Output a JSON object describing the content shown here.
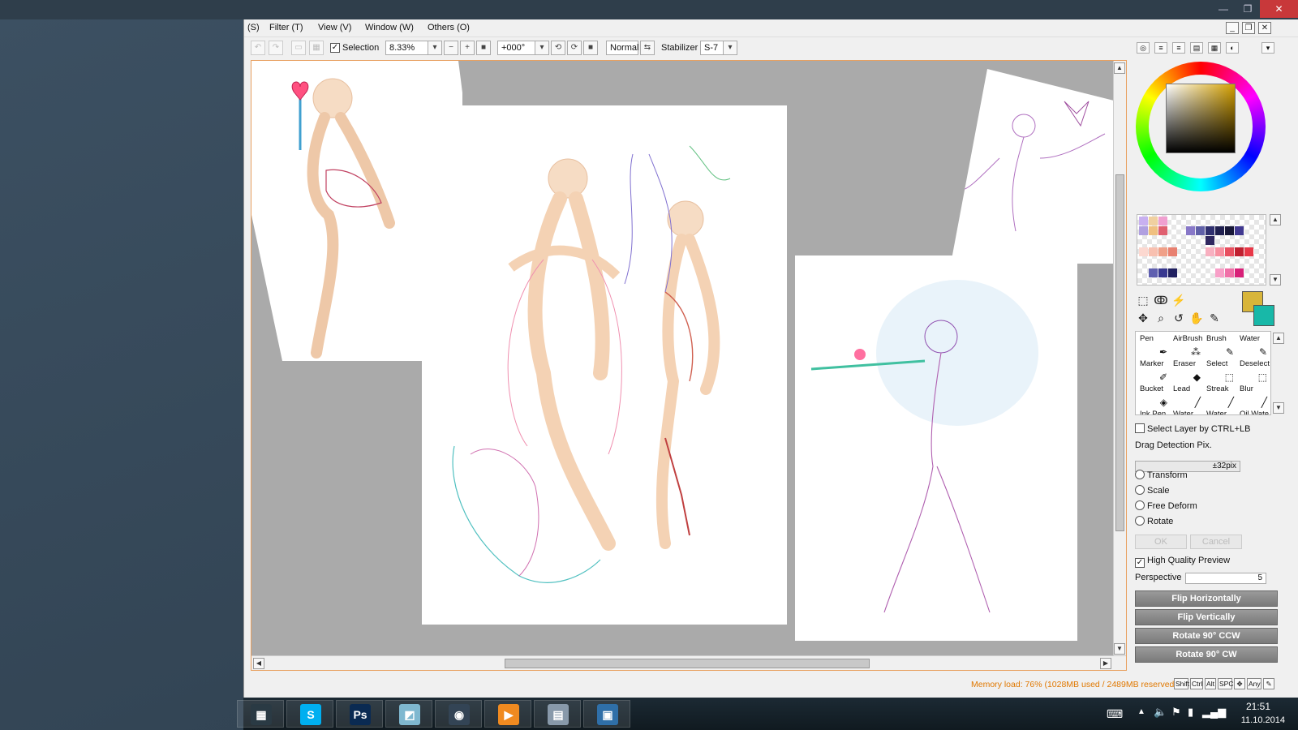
{
  "menu": {
    "items": [
      "(S)",
      "Filter (T)",
      "View (V)",
      "Window (W)",
      "Others (O)"
    ]
  },
  "toolbar": {
    "selection_label": "Selection",
    "selection_checked": true,
    "zoom_value": "8.33%",
    "rotation_value": "+000°",
    "blend_mode": "Normal",
    "stabilizer_label": "Stabilizer",
    "stabilizer_value": "S-7"
  },
  "colors": {
    "foreground": "#d8b53a",
    "background": "#18b8a8",
    "accent_scroll": "#e8a060",
    "memory_warning": "#e07800"
  },
  "brushes": [
    {
      "label": "Pen",
      "icon": "pen-icon"
    },
    {
      "label": "AirBrush",
      "icon": "airbrush-icon"
    },
    {
      "label": "Brush",
      "icon": "brush-icon"
    },
    {
      "label": "Water",
      "icon": "water-icon"
    },
    {
      "label": "Marker",
      "icon": "marker-icon"
    },
    {
      "label": "Eraser",
      "icon": "eraser-icon"
    },
    {
      "label": "Select",
      "icon": "select-icon"
    },
    {
      "label": "Deselect",
      "icon": "deselect-icon"
    },
    {
      "label": "Bucket",
      "icon": "bucket-icon"
    },
    {
      "label": "Lead",
      "icon": "lead-icon"
    },
    {
      "label": "Streak",
      "icon": "streak-icon"
    },
    {
      "label": "Blur",
      "icon": "blur-icon"
    },
    {
      "label": "Ink Pen",
      "icon": "inkpen-icon"
    },
    {
      "label": "Water",
      "icon": "water-icon"
    },
    {
      "label": "Water",
      "icon": "water-icon"
    },
    {
      "label": "Oil Wate",
      "icon": "oil-icon"
    }
  ],
  "transform_panel": {
    "select_layer_label": "Select Layer by CTRL+LB",
    "drag_detection_label": "Drag Detection Pix.",
    "drag_detection_value": "±32pix",
    "radio_options": [
      "Transform",
      "Scale",
      "Free Deform",
      "Rotate"
    ],
    "ok_label": "OK",
    "cancel_label": "Cancel",
    "hq_preview_label": "High Quality Preview",
    "hq_preview_checked": true,
    "perspective_label": "Perspective",
    "perspective_value": "5",
    "actions": [
      "Flip Horizontally",
      "Flip Vertically",
      "Rotate 90° CCW",
      "Rotate 90° CW"
    ]
  },
  "status": {
    "memory_load": "Memory load: 76% (1028MB used / 2489MB reserved)",
    "mod_keys": [
      "Shift",
      "Ctrl",
      "Alt",
      "SPC",
      "✥",
      "Any",
      "✎"
    ]
  },
  "taskbar": {
    "apps": [
      {
        "name": "video-app",
        "glyph": "▦",
        "color": "#2a3a44"
      },
      {
        "name": "skype",
        "glyph": "S",
        "color": "#00aff0"
      },
      {
        "name": "photoshop",
        "glyph": "Ps",
        "color": "#0a2a52"
      },
      {
        "name": "paint-tool-sai",
        "glyph": "◩",
        "color": "#7fb8d0"
      },
      {
        "name": "media-viewer",
        "glyph": "◉",
        "color": "#334455"
      },
      {
        "name": "media-player",
        "glyph": "▶",
        "color": "#f08a20"
      },
      {
        "name": "file-manager",
        "glyph": "▤",
        "color": "#8899aa"
      },
      {
        "name": "photo-viewer",
        "glyph": "▣",
        "color": "#2f6fa8"
      }
    ],
    "time": "21:51",
    "date": "11.10.2014"
  }
}
